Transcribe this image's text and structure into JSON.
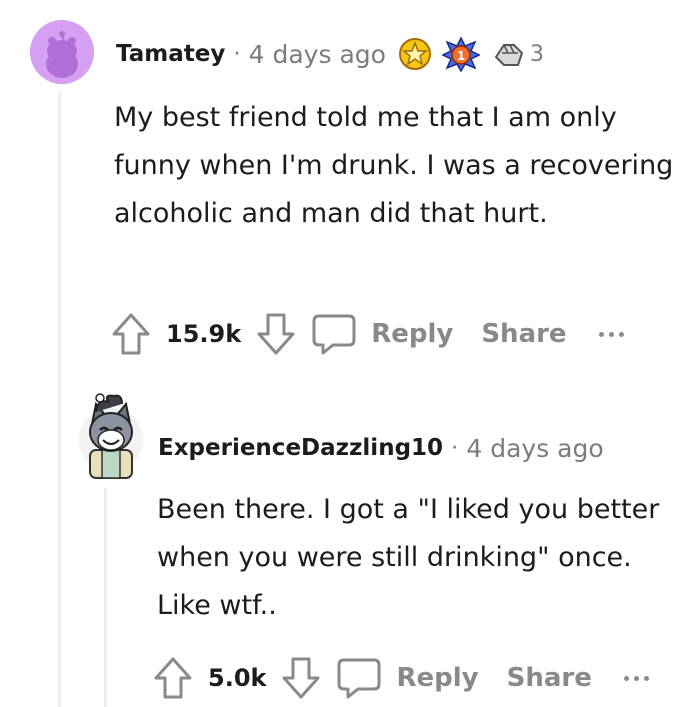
{
  "comments": [
    {
      "username": "Tamatey",
      "separator": "·",
      "timestamp": "4 days ago",
      "award_count": "3",
      "text": "My best friend told me that I am only funny when I'm drunk. I was a recovering alcoholic and man did that hurt.",
      "votes": "15.9k",
      "reply_label": "Reply",
      "share_label": "Share"
    },
    {
      "username": "ExperienceDazzling10",
      "separator": "·",
      "timestamp": "4 days ago",
      "text": "Been there. I got a \"I liked you better when you were still drinking\" once. Like wtf..",
      "votes": "5.0k",
      "reply_label": "Reply",
      "share_label": "Share"
    }
  ],
  "icons": {
    "upvote": "arrow-up-outline",
    "downvote": "arrow-down-outline",
    "reply": "speech-bubble-outline",
    "more": "three-dots-horizontal"
  }
}
